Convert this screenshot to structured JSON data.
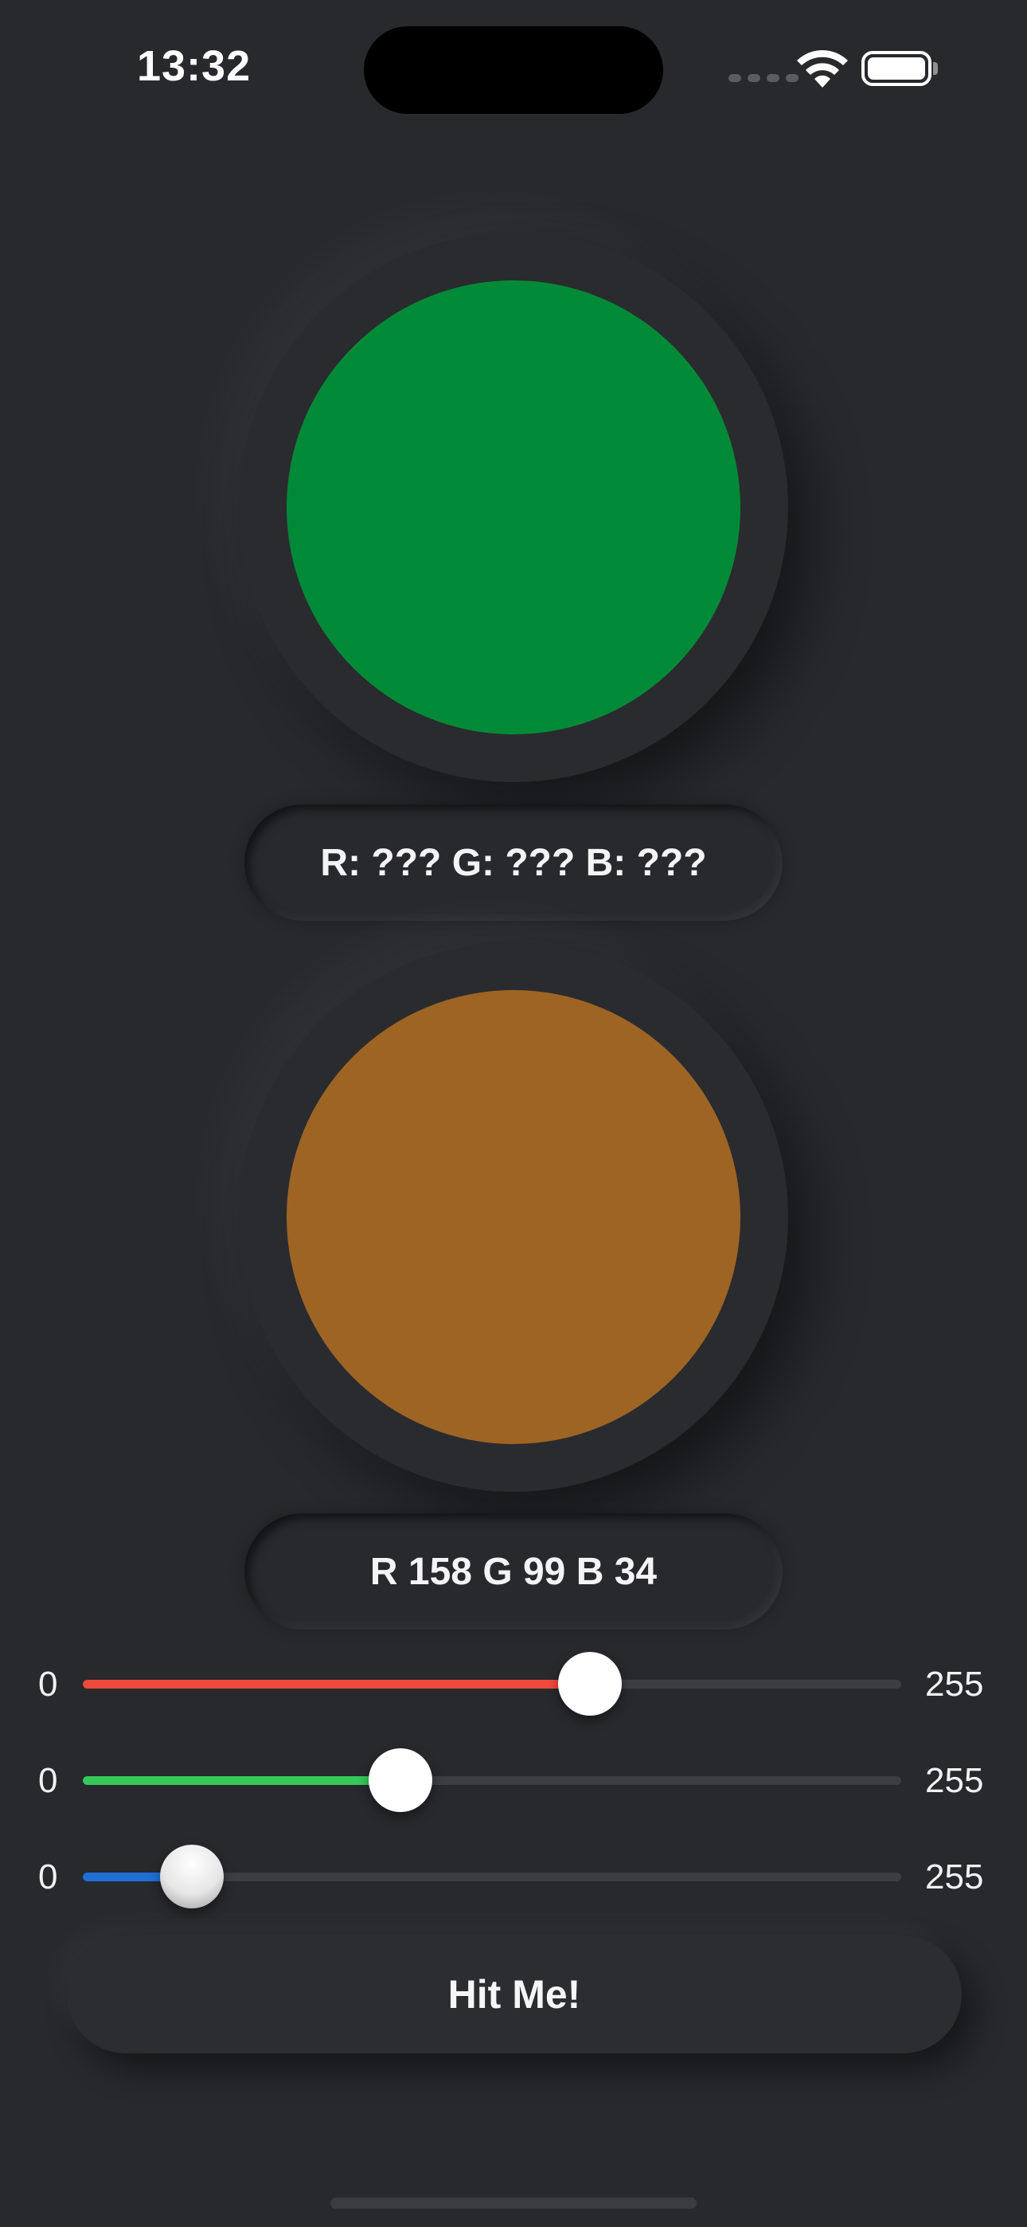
{
  "status_bar": {
    "time": "13:32"
  },
  "target": {
    "color": "#008a37",
    "label": "R: ??? G: ??? B: ???"
  },
  "guess": {
    "color": "#9d6424",
    "label": "R 158 G 99 B 34"
  },
  "sliders": [
    {
      "channel": "red",
      "min_label": "0",
      "max_label": "255",
      "value": 158,
      "max": 255,
      "color": "#ef4a3c"
    },
    {
      "channel": "green",
      "min_label": "0",
      "max_label": "255",
      "value": 99,
      "max": 255,
      "color": "#35c759"
    },
    {
      "channel": "blue",
      "min_label": "0",
      "max_label": "255",
      "value": 34,
      "max": 255,
      "color": "#1f6fd6"
    }
  ],
  "action": {
    "button_label": "Hit Me!"
  }
}
